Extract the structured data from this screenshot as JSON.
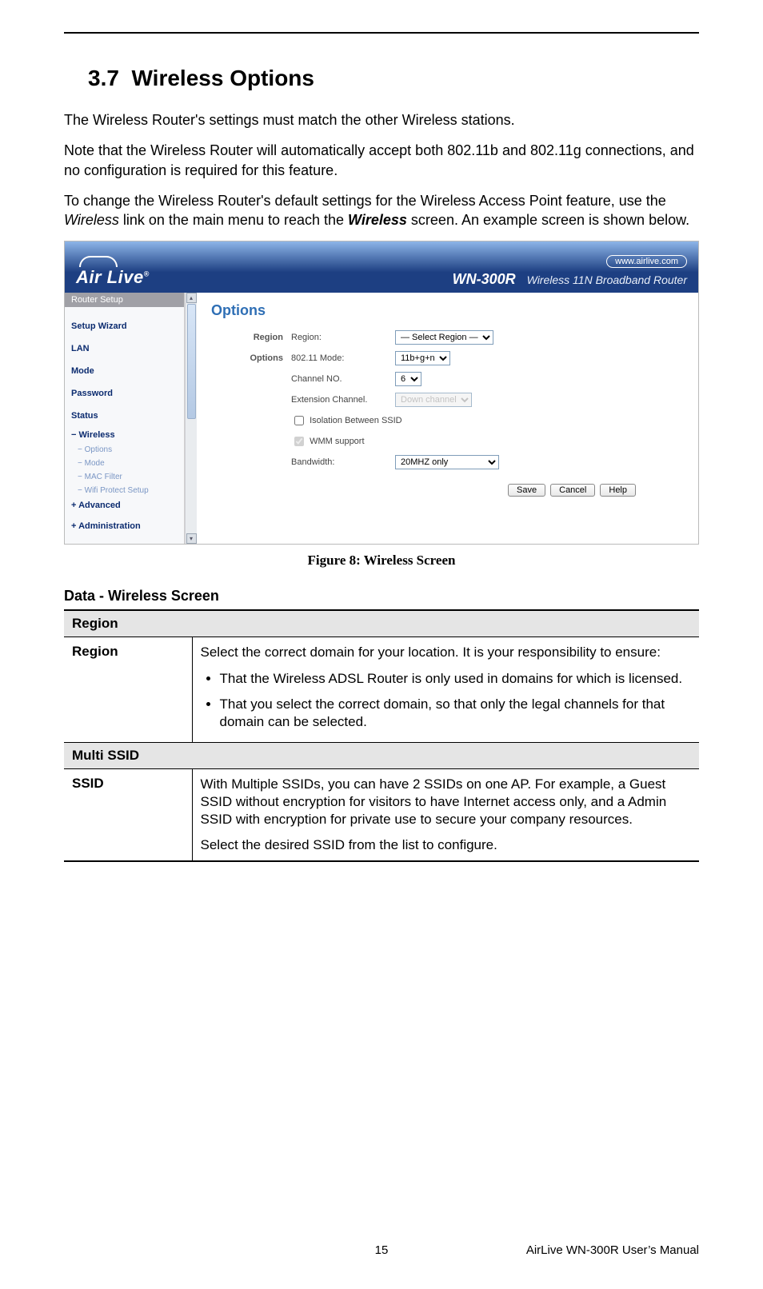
{
  "page": {
    "section_number": "3.7",
    "section_title": "Wireless Options",
    "para1": "The Wireless Router's settings must match the other Wireless stations.",
    "para2": "Note that the Wireless Router will automatically accept both 802.11b and 802.11g connections, and no configuration is required for this feature.",
    "para3_a": "To change the Wireless Router's default settings for the Wireless Access Point feature, use the ",
    "para3_em": "Wireless",
    "para3_b": " link on the main menu to reach the ",
    "para3_strong": "Wireless",
    "para3_c": " screen. An example screen is shown below.",
    "figure_caption": "Figure 8: Wireless Screen",
    "sub_heading": "Data - Wireless Screen",
    "footer_page": "15",
    "footer_manual": "AirLive WN-300R User’s Manual"
  },
  "router": {
    "logo_text": "Air Live",
    "logo_reg": "®",
    "url": "www.airlive.com",
    "model": "WN-300R",
    "model_desc": "Wireless 11N Broadband Router",
    "sidebar": {
      "title": "Router Setup",
      "items": [
        "Setup Wizard",
        "LAN",
        "Mode",
        "Password",
        "Status"
      ],
      "wireless": "Wireless",
      "wireless_prefix": "−",
      "subs": [
        "Options",
        "Mode",
        "MAC Filter",
        "Wifi Protect Setup"
      ],
      "sub_prefix": "−",
      "advanced_prefix": "+",
      "advanced": "Advanced",
      "admin_prefix": "+",
      "admin": "Administration"
    },
    "content": {
      "title": "Options",
      "region_label": "Region",
      "region_field": "Region:",
      "region_value": "— Select Region —",
      "options_label": "Options",
      "mode_field": "802.11 Mode:",
      "mode_value": "11b+g+n",
      "channel_field": "Channel NO.",
      "channel_value": "6",
      "ext_field": "Extension Channel.",
      "ext_value": "Down channel",
      "isolation_label": "Isolation Between SSID",
      "wmm_label": "WMM support",
      "bandwidth_field": "Bandwidth:",
      "bandwidth_value": "20MHZ only",
      "save": "Save",
      "cancel": "Cancel",
      "help": "Help"
    }
  },
  "table": {
    "section1": "Region",
    "row1_label": "Region",
    "row1_p1": "Select the correct domain for your location. It is your responsibility to ensure:",
    "row1_li1": "That the Wireless ADSL Router is only used in domains for which is licensed.",
    "row1_li2": "That you select the correct domain, so that only the legal channels for that domain can be selected.",
    "section2": "Multi SSID",
    "row2_label": "SSID",
    "row2_p1": "With Multiple SSIDs, you can have 2 SSIDs on one AP. For example, a Guest SSID without encryption for visitors to have Internet access only, and a Admin SSID with encryption for private use to secure your company resources.",
    "row2_p2": "Select the desired SSID from the list to configure."
  }
}
